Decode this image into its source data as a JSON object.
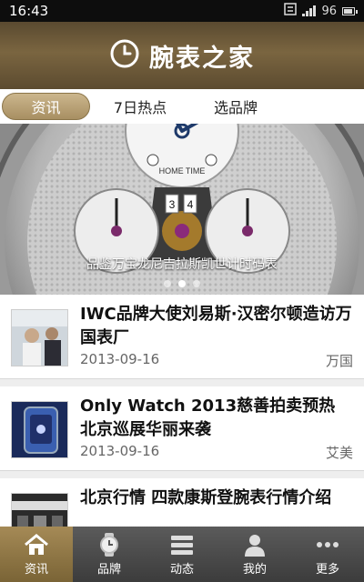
{
  "status_bar": {
    "time": "16:43",
    "battery_level": "96"
  },
  "header": {
    "title": "腕表之家",
    "logo_icon": "clock-logo-icon"
  },
  "tabs": [
    {
      "label": "资讯",
      "active": true
    },
    {
      "label": "7日热点",
      "active": false
    },
    {
      "label": "选品牌",
      "active": false
    }
  ],
  "banner": {
    "caption": "品鉴万宝龙尼吉拉斯凯世计时码表",
    "dial_text": "HOME TIME",
    "dial_numbers": [
      "3",
      "4"
    ],
    "page_count": 3,
    "current_page": 2
  },
  "news": [
    {
      "headline": "IWC品牌大使刘易斯·汉密尔顿造访万国表厂",
      "date": "2013-09-16",
      "source": "万国"
    },
    {
      "headline": "Only Watch 2013慈善拍卖预热 北京巡展华丽来袭",
      "date": "2013-09-16",
      "source": "艾美"
    },
    {
      "headline": "北京行情 四款康斯登腕表行情介绍",
      "date": "",
      "source": ""
    }
  ],
  "bottom_nav": [
    {
      "label": "资讯",
      "icon": "home-icon",
      "active": true
    },
    {
      "label": "品牌",
      "icon": "watch-icon",
      "active": false
    },
    {
      "label": "动态",
      "icon": "list-icon",
      "active": false
    },
    {
      "label": "我的",
      "icon": "user-icon",
      "active": false
    },
    {
      "label": "更多",
      "icon": "more-icon",
      "active": false
    }
  ],
  "colors": {
    "accent_gold": "#a88f62",
    "header_brown": "#6b5838",
    "nav_dark": "#4a4a4a"
  }
}
